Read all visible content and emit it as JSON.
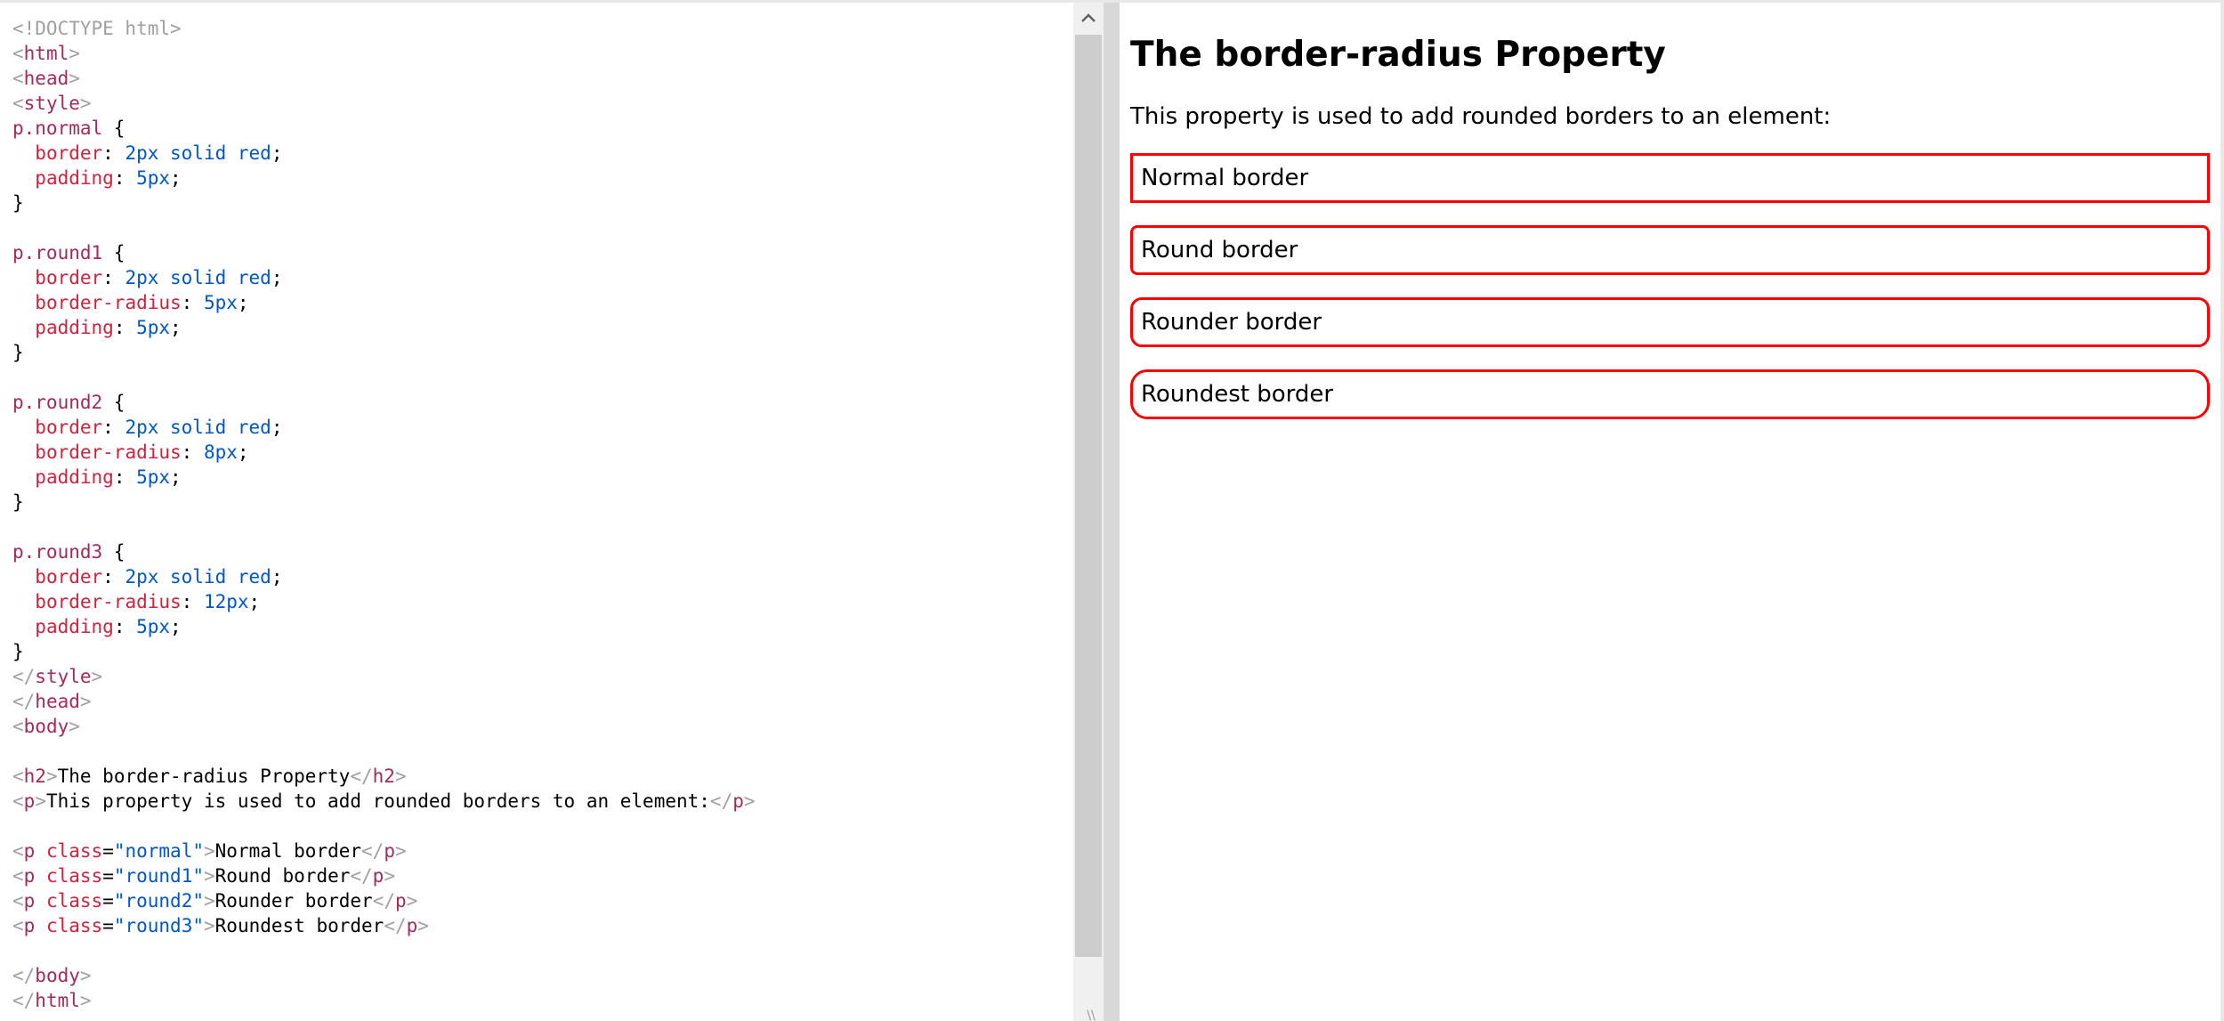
{
  "editor": {
    "lines": [
      [
        {
          "t": "br",
          "v": "<!DOCTYPE html>"
        }
      ],
      [
        {
          "t": "br",
          "v": "<"
        },
        {
          "t": "tag",
          "v": "html"
        },
        {
          "t": "br",
          "v": ">"
        }
      ],
      [
        {
          "t": "br",
          "v": "<"
        },
        {
          "t": "tag",
          "v": "head"
        },
        {
          "t": "br",
          "v": ">"
        }
      ],
      [
        {
          "t": "br",
          "v": "<"
        },
        {
          "t": "tag",
          "v": "style"
        },
        {
          "t": "br",
          "v": ">"
        }
      ],
      [
        {
          "t": "sel",
          "v": "p.normal"
        },
        {
          "t": "txt",
          "v": " {"
        }
      ],
      [
        {
          "t": "txt",
          "v": "  "
        },
        {
          "t": "prop",
          "v": "border"
        },
        {
          "t": "txt",
          "v": ": "
        },
        {
          "t": "val",
          "v": "2px solid red"
        },
        {
          "t": "txt",
          "v": ";"
        }
      ],
      [
        {
          "t": "txt",
          "v": "  "
        },
        {
          "t": "prop",
          "v": "padding"
        },
        {
          "t": "txt",
          "v": ": "
        },
        {
          "t": "val",
          "v": "5px"
        },
        {
          "t": "txt",
          "v": ";"
        }
      ],
      [
        {
          "t": "txt",
          "v": "}"
        }
      ],
      [
        {
          "t": "txt",
          "v": ""
        }
      ],
      [
        {
          "t": "sel",
          "v": "p.round1"
        },
        {
          "t": "txt",
          "v": " {"
        }
      ],
      [
        {
          "t": "txt",
          "v": "  "
        },
        {
          "t": "prop",
          "v": "border"
        },
        {
          "t": "txt",
          "v": ": "
        },
        {
          "t": "val",
          "v": "2px solid red"
        },
        {
          "t": "txt",
          "v": ";"
        }
      ],
      [
        {
          "t": "txt",
          "v": "  "
        },
        {
          "t": "prop",
          "v": "border-radius"
        },
        {
          "t": "txt",
          "v": ": "
        },
        {
          "t": "val",
          "v": "5px"
        },
        {
          "t": "txt",
          "v": ";"
        }
      ],
      [
        {
          "t": "txt",
          "v": "  "
        },
        {
          "t": "prop",
          "v": "padding"
        },
        {
          "t": "txt",
          "v": ": "
        },
        {
          "t": "val",
          "v": "5px"
        },
        {
          "t": "txt",
          "v": ";"
        }
      ],
      [
        {
          "t": "txt",
          "v": "}"
        }
      ],
      [
        {
          "t": "txt",
          "v": ""
        }
      ],
      [
        {
          "t": "sel",
          "v": "p.round2"
        },
        {
          "t": "txt",
          "v": " {"
        }
      ],
      [
        {
          "t": "txt",
          "v": "  "
        },
        {
          "t": "prop",
          "v": "border"
        },
        {
          "t": "txt",
          "v": ": "
        },
        {
          "t": "val",
          "v": "2px solid red"
        },
        {
          "t": "txt",
          "v": ";"
        }
      ],
      [
        {
          "t": "txt",
          "v": "  "
        },
        {
          "t": "prop",
          "v": "border-radius"
        },
        {
          "t": "txt",
          "v": ": "
        },
        {
          "t": "val",
          "v": "8px"
        },
        {
          "t": "txt",
          "v": ";"
        }
      ],
      [
        {
          "t": "txt",
          "v": "  "
        },
        {
          "t": "prop",
          "v": "padding"
        },
        {
          "t": "txt",
          "v": ": "
        },
        {
          "t": "val",
          "v": "5px"
        },
        {
          "t": "txt",
          "v": ";"
        }
      ],
      [
        {
          "t": "txt",
          "v": "}"
        }
      ],
      [
        {
          "t": "txt",
          "v": ""
        }
      ],
      [
        {
          "t": "sel",
          "v": "p.round3"
        },
        {
          "t": "txt",
          "v": " {"
        }
      ],
      [
        {
          "t": "txt",
          "v": "  "
        },
        {
          "t": "prop",
          "v": "border"
        },
        {
          "t": "txt",
          "v": ": "
        },
        {
          "t": "val",
          "v": "2px solid red"
        },
        {
          "t": "txt",
          "v": ";"
        }
      ],
      [
        {
          "t": "txt",
          "v": "  "
        },
        {
          "t": "prop",
          "v": "border-radius"
        },
        {
          "t": "txt",
          "v": ": "
        },
        {
          "t": "val",
          "v": "12px"
        },
        {
          "t": "txt",
          "v": ";"
        }
      ],
      [
        {
          "t": "txt",
          "v": "  "
        },
        {
          "t": "prop",
          "v": "padding"
        },
        {
          "t": "txt",
          "v": ": "
        },
        {
          "t": "val",
          "v": "5px"
        },
        {
          "t": "txt",
          "v": ";"
        }
      ],
      [
        {
          "t": "txt",
          "v": "}"
        }
      ],
      [
        {
          "t": "br",
          "v": "</"
        },
        {
          "t": "tag",
          "v": "style"
        },
        {
          "t": "br",
          "v": ">"
        }
      ],
      [
        {
          "t": "br",
          "v": "</"
        },
        {
          "t": "tag",
          "v": "head"
        },
        {
          "t": "br",
          "v": ">"
        }
      ],
      [
        {
          "t": "br",
          "v": "<"
        },
        {
          "t": "tag",
          "v": "body"
        },
        {
          "t": "br",
          "v": ">"
        }
      ],
      [
        {
          "t": "txt",
          "v": ""
        }
      ],
      [
        {
          "t": "br",
          "v": "<"
        },
        {
          "t": "tag",
          "v": "h2"
        },
        {
          "t": "br",
          "v": ">"
        },
        {
          "t": "txt",
          "v": "The border-radius Property"
        },
        {
          "t": "br",
          "v": "</"
        },
        {
          "t": "tag",
          "v": "h2"
        },
        {
          "t": "br",
          "v": ">"
        }
      ],
      [
        {
          "t": "br",
          "v": "<"
        },
        {
          "t": "tag",
          "v": "p"
        },
        {
          "t": "br",
          "v": ">"
        },
        {
          "t": "txt",
          "v": "This property is used to add rounded borders to an element:"
        },
        {
          "t": "br",
          "v": "</"
        },
        {
          "t": "tag",
          "v": "p"
        },
        {
          "t": "br",
          "v": ">"
        }
      ],
      [
        {
          "t": "txt",
          "v": ""
        }
      ],
      [
        {
          "t": "br",
          "v": "<"
        },
        {
          "t": "tag",
          "v": "p"
        },
        {
          "t": "txt",
          "v": " "
        },
        {
          "t": "attr",
          "v": "class"
        },
        {
          "t": "txt",
          "v": "="
        },
        {
          "t": "str",
          "v": "\"normal\""
        },
        {
          "t": "br",
          "v": ">"
        },
        {
          "t": "txt",
          "v": "Normal border"
        },
        {
          "t": "br",
          "v": "</"
        },
        {
          "t": "tag",
          "v": "p"
        },
        {
          "t": "br",
          "v": ">"
        }
      ],
      [
        {
          "t": "br",
          "v": "<"
        },
        {
          "t": "tag",
          "v": "p"
        },
        {
          "t": "txt",
          "v": " "
        },
        {
          "t": "attr",
          "v": "class"
        },
        {
          "t": "txt",
          "v": "="
        },
        {
          "t": "str",
          "v": "\"round1\""
        },
        {
          "t": "br",
          "v": ">"
        },
        {
          "t": "txt",
          "v": "Round border"
        },
        {
          "t": "br",
          "v": "</"
        },
        {
          "t": "tag",
          "v": "p"
        },
        {
          "t": "br",
          "v": ">"
        }
      ],
      [
        {
          "t": "br",
          "v": "<"
        },
        {
          "t": "tag",
          "v": "p"
        },
        {
          "t": "txt",
          "v": " "
        },
        {
          "t": "attr",
          "v": "class"
        },
        {
          "t": "txt",
          "v": "="
        },
        {
          "t": "str",
          "v": "\"round2\""
        },
        {
          "t": "br",
          "v": ">"
        },
        {
          "t": "txt",
          "v": "Rounder border"
        },
        {
          "t": "br",
          "v": "</"
        },
        {
          "t": "tag",
          "v": "p"
        },
        {
          "t": "br",
          "v": ">"
        }
      ],
      [
        {
          "t": "br",
          "v": "<"
        },
        {
          "t": "tag",
          "v": "p"
        },
        {
          "t": "txt",
          "v": " "
        },
        {
          "t": "attr",
          "v": "class"
        },
        {
          "t": "txt",
          "v": "="
        },
        {
          "t": "str",
          "v": "\"round3\""
        },
        {
          "t": "br",
          "v": ">"
        },
        {
          "t": "txt",
          "v": "Roundest border"
        },
        {
          "t": "br",
          "v": "</"
        },
        {
          "t": "tag",
          "v": "p"
        },
        {
          "t": "br",
          "v": ">"
        }
      ],
      [
        {
          "t": "txt",
          "v": ""
        }
      ],
      [
        {
          "t": "br",
          "v": "</"
        },
        {
          "t": "tag",
          "v": "body"
        },
        {
          "t": "br",
          "v": ">"
        }
      ],
      [
        {
          "t": "br",
          "v": "</"
        },
        {
          "t": "tag",
          "v": "html"
        },
        {
          "t": "br",
          "v": ">"
        }
      ]
    ]
  },
  "scrollbar": {
    "up_icon": "chevron-up-icon",
    "corner_glyph": "\\\\"
  },
  "result": {
    "title": "The border-radius Property",
    "description": "This property is used to add rounded borders to an element:",
    "boxes": {
      "normal": "Normal border",
      "round1": "Round border",
      "round2": "Rounder border",
      "round3": "Roundest border"
    },
    "border_color": "#ff0000"
  },
  "colors": {
    "bracket": "#a0a0a0",
    "tag": "#a52a5a",
    "property": "#d0233f",
    "value": "#0057c8",
    "text": "#000000"
  }
}
